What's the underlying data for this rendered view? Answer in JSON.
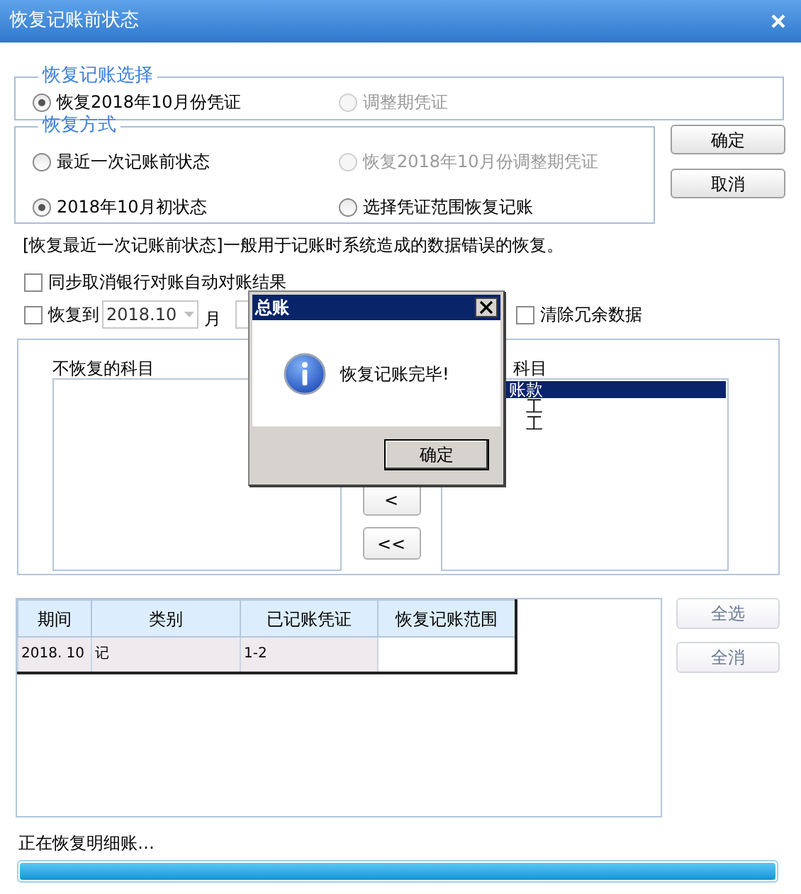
{
  "window": {
    "title": "恢复记账前状态"
  },
  "record_selection": {
    "legend": "恢复记账选择",
    "options": [
      {
        "label": "恢复2018年10月份凭证",
        "selected": true,
        "disabled": false
      },
      {
        "label": "调整期凭证",
        "selected": false,
        "disabled": true
      }
    ]
  },
  "restore_method": {
    "legend": "恢复方式",
    "options": [
      {
        "label": "最近一次记账前状态",
        "selected": false,
        "disabled": false
      },
      {
        "label": "恢复2018年10月份调整期凭证",
        "selected": false,
        "disabled": true
      },
      {
        "label": "2018年10月初状态",
        "selected": true,
        "disabled": false
      },
      {
        "label": "选择凭证范围恢复记账",
        "selected": false,
        "disabled": false
      }
    ]
  },
  "buttons": [
    {
      "label": "确定"
    },
    {
      "label": "取消"
    }
  ],
  "description": "[恢复最近一次记账前状态]一般用于记账时系统造成的数据错误的恢复。",
  "sync_checkbox": {
    "label": "同步取消银行对账自动对账结果",
    "checked": false
  },
  "restore_to": {
    "label": "恢复到",
    "checked": false,
    "date": "2018.10",
    "unit": "月"
  },
  "clear_checkbox": {
    "label": "清除冗余数据",
    "checked": false
  },
  "subjects": {
    "left_label": "不恢复的科目",
    "right_label": "科目",
    "right_items": [
      {
        "label": "账款",
        "selected": true
      },
      {
        "label": "工",
        "selected": false
      },
      {
        "label": "工",
        "selected": false
      }
    ],
    "move_buttons": [
      "<",
      "<<"
    ]
  },
  "table": {
    "columns": [
      "期间",
      "类别",
      "已记账凭证",
      "恢复记账范围"
    ],
    "rows": [
      [
        "2018. 10",
        "记",
        "1-2"
      ]
    ]
  },
  "side_buttons": [
    {
      "label": "全选",
      "disabled": true
    },
    {
      "label": "全消",
      "disabled": true
    }
  ],
  "status": {
    "text": "正在恢复明细账…",
    "level": 1
  },
  "dialog": {
    "title": "总账",
    "message": "恢复记账完毕!",
    "button": "确定"
  }
}
